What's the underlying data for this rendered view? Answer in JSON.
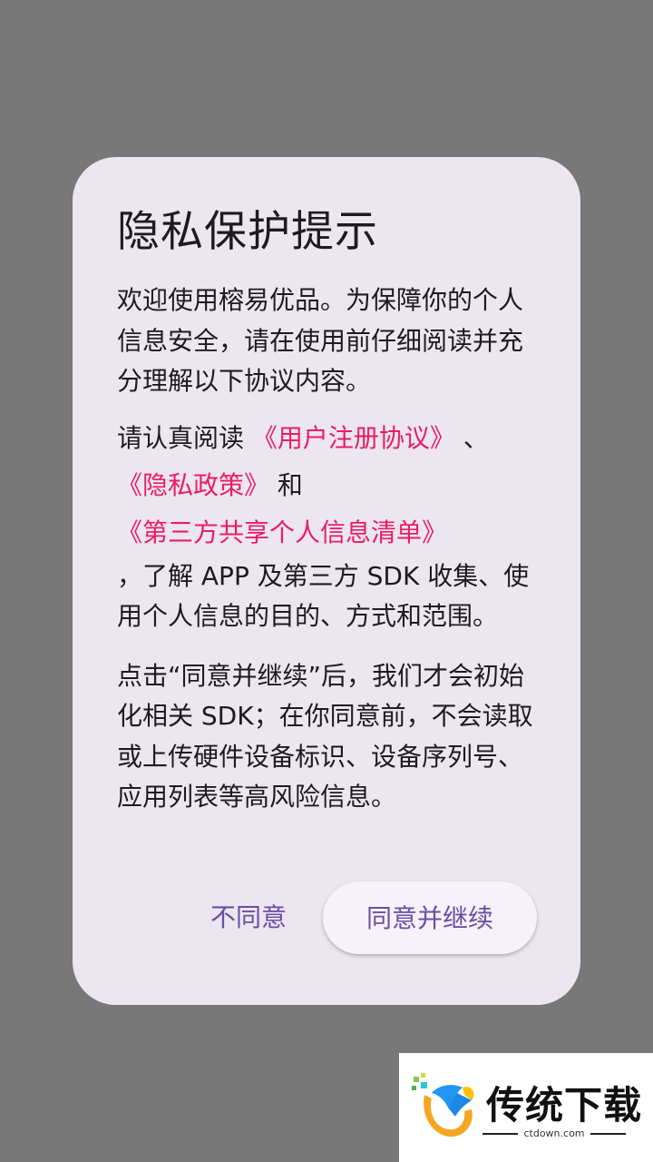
{
  "dialog": {
    "title": "隐私保护提示",
    "intro": "欢迎使用榕易优品。为保障你的个人信息安全，请在使用前仔细阅读并充分理解以下协议内容。",
    "read_prefix": "请认真阅读",
    "link_user_agreement": "《用户注册协议》",
    "separator": "、",
    "link_privacy_policy": "《隐私政策》",
    "and": "和",
    "link_third_party": "《第三方共享个人信息清单》",
    "read_suffix": "，了解 APP 及第三方 SDK 收集、使用个人信息的目的、方式和范围。",
    "notice": "点击“同意并继续”后，我们才会初始化相关 SDK；在你同意前，不会读取或上传硬件设备标识、设备序列号、应用列表等高风险信息。",
    "disagree_label": "不同意",
    "agree_label": "同意并继续"
  },
  "watermark": {
    "name": "传统下载",
    "url": "ctdown.com"
  },
  "colors": {
    "scrim": "#787878",
    "dialog_bg": "#ECE6F0",
    "link": "#E91E63",
    "button_text": "#6750A4"
  }
}
